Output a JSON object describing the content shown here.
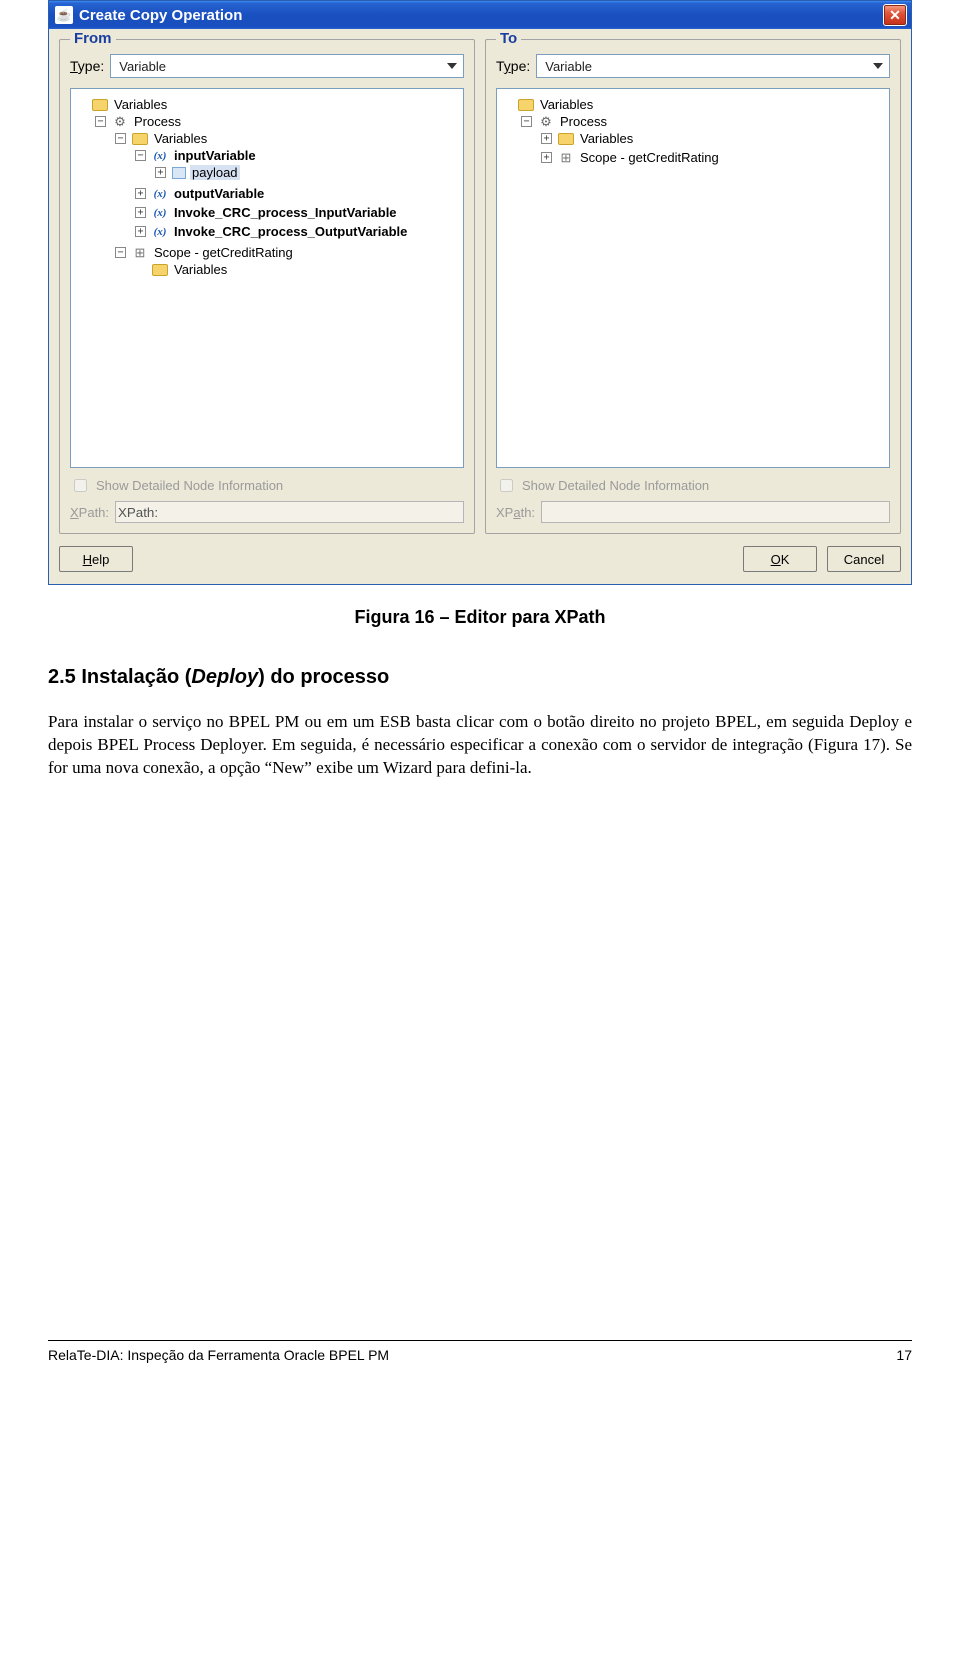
{
  "window": {
    "title": "Create Copy Operation",
    "from": {
      "legend": "From",
      "type_label": "Type:",
      "type_value": "Variable",
      "show_detail_label": "Show Detailed Node Information",
      "xpath_label": "XPath:",
      "tree": {
        "root": "Variables",
        "process": "Process",
        "varfolder": "Variables",
        "inputVar": "inputVariable",
        "payload": "payload",
        "outputVar": "outputVariable",
        "invokeIn": "Invoke_CRC_process_InputVariable",
        "invokeOut": "Invoke_CRC_process_OutputVariable",
        "scope": "Scope - getCreditRating",
        "scopeVars": "Variables"
      }
    },
    "to": {
      "legend": "To",
      "type_label": "Type:",
      "type_value": "Variable",
      "show_detail_label": "Show Detailed Node Information",
      "xpath_label": "XPath:",
      "tree": {
        "root": "Variables",
        "process": "Process",
        "varfolder": "Variables",
        "scope": "Scope - getCreditRating"
      }
    },
    "buttons": {
      "help": "Help",
      "ok": "OK",
      "cancel": "Cancel"
    }
  },
  "doc": {
    "caption": "Figura 16 – Editor para XPath",
    "heading_num": "2.5",
    "heading_rest_before": " Instalação (",
    "heading_italic": "Deploy",
    "heading_rest_after": ") do processo",
    "para": "Para instalar o serviço no BPEL PM ou em um ESB basta clicar com o botão direito no projeto BPEL, em seguida Deploy e depois BPEL Process Deployer. Em seguida, é necessário especificar a conexão com o servidor de integração (Figura 17). Se for uma nova conexão, a opção “New” exibe um Wizard para defini-la.",
    "footer_left": "RelaTe-DIA: Inspeção da Ferramenta Oracle BPEL PM",
    "footer_right": "17"
  }
}
